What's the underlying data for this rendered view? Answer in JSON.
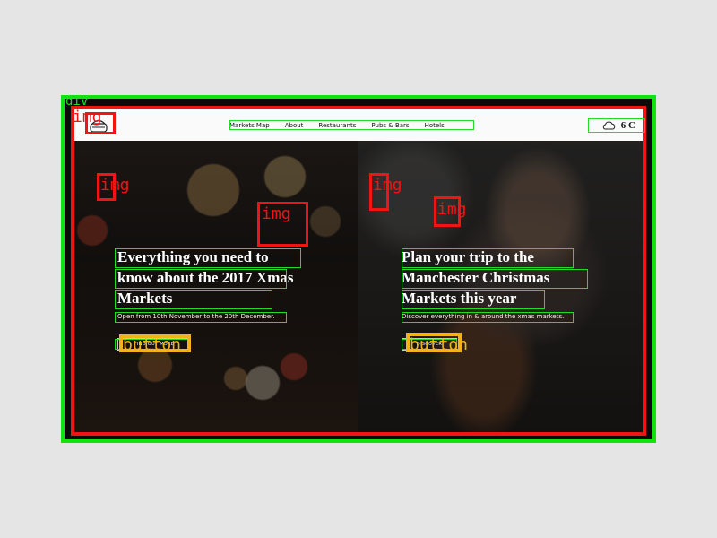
{
  "header": {
    "nav": [
      "Markets Map",
      "About",
      "Restaurants",
      "Pubs & Bars",
      "Hotels"
    ],
    "weather": {
      "icon": "cloud-icon",
      "temp": "6 C"
    }
  },
  "hero_left": {
    "title": "Everything you need to know about the 2017 Xmas Markets",
    "subtitle": "Open from 10th November to the 20th December.",
    "button": "Find out more"
  },
  "hero_right": {
    "title": "Plan your trip to the Manchester Christmas Markets this year",
    "subtitle": "Discover everything in & around the xmas markets.",
    "button": "Discover"
  },
  "annotations": {
    "img": "img",
    "button": "button",
    "top_tag": "div"
  },
  "colors": {
    "green": "#11e311",
    "red": "#f01414",
    "orange": "#f2b318"
  }
}
